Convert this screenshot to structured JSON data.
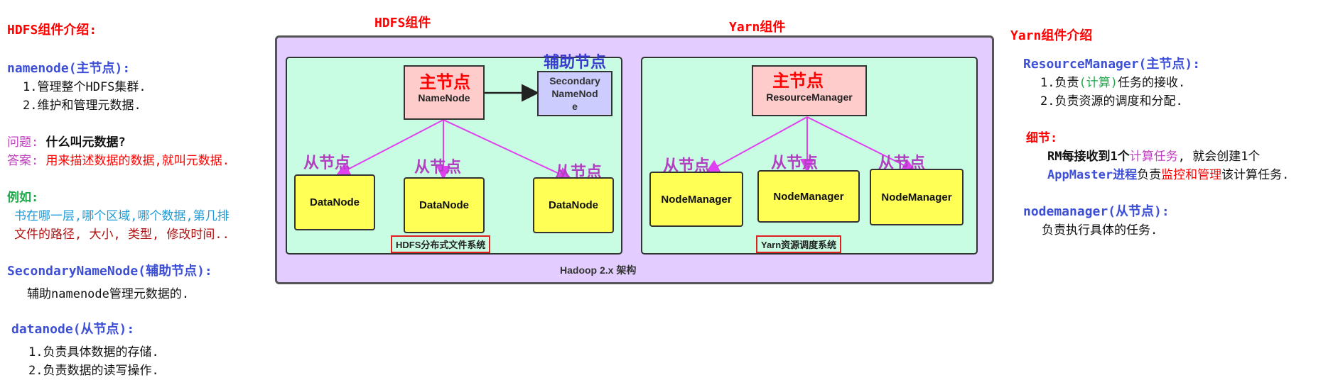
{
  "left": {
    "hdfs_intro_title": "HDFS组件介绍:",
    "namenode": {
      "title": "namenode(主节点):",
      "items": [
        "1.管理整个HDFS集群.",
        "2.维护和管理元数据."
      ]
    },
    "qa": {
      "q_label": "问题:",
      "q_text": "什么叫元数据?",
      "a_label": "答案:",
      "a_text": "用来描述数据的数据,就叫元数据."
    },
    "example": {
      "label": "例如:",
      "line1": "书在哪一层,哪个区域,哪个数据,第几排",
      "line2": "文件的路径, 大小, 类型, 修改时间.."
    },
    "secondary": {
      "title": "SecondaryNameNode(辅助节点):",
      "desc": "辅助namenode管理元数据的."
    },
    "datanode": {
      "title": "datanode(从节点):",
      "items": [
        "1.负责具体数据的存储.",
        "2.负责数据的读写操作."
      ]
    }
  },
  "diagram": {
    "hdfs_header": "HDFS组件",
    "yarn_header": "Yarn组件",
    "outer_caption": "Hadoop 2.x 架构",
    "hdfs": {
      "master_tag": "主节点",
      "master_name": "NameNode",
      "aux_tag": "辅助节点",
      "secondary_lines": [
        "Secondary",
        "NameNod",
        "e"
      ],
      "slave_tag": "从节点",
      "data_nodes": [
        "DataNode",
        "DataNode",
        "DataNode"
      ],
      "caption": "HDFS分布式文件系统"
    },
    "yarn": {
      "master_tag": "主节点",
      "master_name": "ResourceManager",
      "slave_tag": "从节点",
      "node_managers": [
        "NodeManager",
        "NodeManager",
        "NodeManager"
      ],
      "caption": "Yarn资源调度系统"
    },
    "colors": {
      "outer_bg": "#e3ccff",
      "panel_bg": "#c9fde3",
      "node_bg": "#ffff55",
      "master_bg": "#ffcccc",
      "secondary_bg": "#ccccff",
      "arrow": "#e040f0"
    }
  },
  "right": {
    "yarn_intro_title": "Yarn组件介绍",
    "rm": {
      "title": "ResourceManager(主节点):",
      "item1_pre": "1.负责",
      "item1_hl": "(计算)",
      "item1_post": "任务的接收.",
      "item2": "2.负责资源的调度和分配."
    },
    "detail": {
      "label": "细节:",
      "l1_a": "RM每接收到1个",
      "l1_b": "计算任务",
      "l1_c": ", 就会创建1个",
      "l2_a": "AppMaster进程",
      "l2_b": "负责",
      "l2_c": "监控和管理",
      "l2_d": "该计算任务."
    },
    "nm": {
      "title": "nodemanager(从节点):",
      "desc": "负责执行具体的任务."
    }
  }
}
